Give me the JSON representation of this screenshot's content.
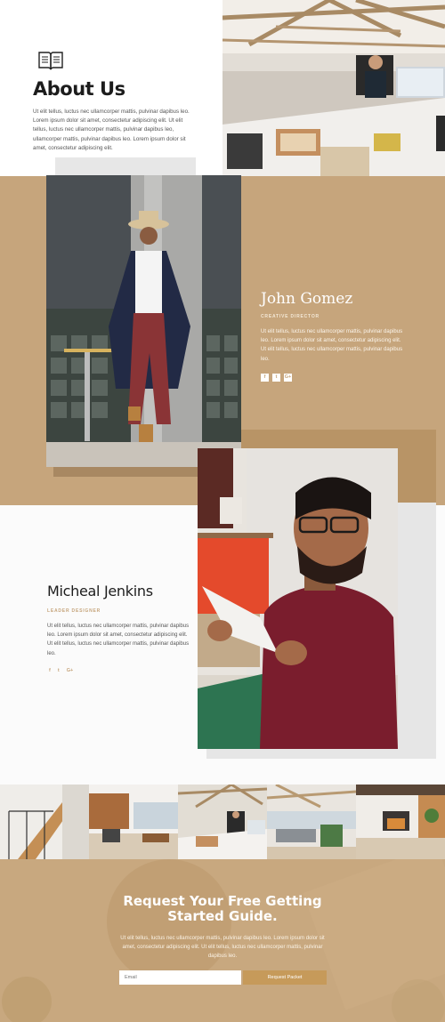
{
  "about": {
    "title": "About Us",
    "body": "Ut elit tellus, luctus nec ullamcorper mattis, pulvinar dapibus leo. Lorem ipsum dolor sit amet, consectetur adipiscing elit. Ut elit tellus, luctus nec ullamcorper mattis, pulvinar dapibus leo, ullamcorper mattis, pulvinar dapibus leo. Lorem ipsum dolor sit amet, consectetur adipiscing elit.",
    "icon": "book-icon"
  },
  "member1": {
    "name": "John Gomez",
    "role": "CREATIVE DIRECTOR",
    "body": "Ut elit tellus, luctus nec ullamcorper mattis, pulvinar dapibus leo. Lorem ipsum dolor sit amet, consectetur adipiscing elit. Ut elit tellus, luctus nec ullamcorper mattis, pulvinar dapibus leo.",
    "social": [
      "f",
      "t",
      "G+"
    ]
  },
  "member2": {
    "name": "Micheal Jenkins",
    "role": "LEADER DESIGNER",
    "body": "Ut elit tellus, luctus nec ullamcorper mattis, pulvinar dapibus leo. Lorem ipsum dolor sit amet, consectetur adipiscing elit. Ut elit tellus, luctus nec ullamcorper mattis, pulvinar dapibus leo.",
    "social": [
      "f",
      "t",
      "G+"
    ]
  },
  "cta": {
    "title_line1": "Request Your Free Getting",
    "title_line2": "Started Guide.",
    "body": "Ut elit tellus, luctus nec ullamcorper mattis, pulvinar dapibus leo. Lorem ipsum dolor sit amet, consectetur adipiscing elit. Ut elit tellus, luctus nec ullamcorper mattis, pulvinar dapibus leo.",
    "email_placeholder": "Email",
    "button_label": "Request Packet"
  },
  "colors": {
    "accent": "#c6a57c",
    "dark_text": "#1c1c1c",
    "button": "#c69a5a"
  }
}
